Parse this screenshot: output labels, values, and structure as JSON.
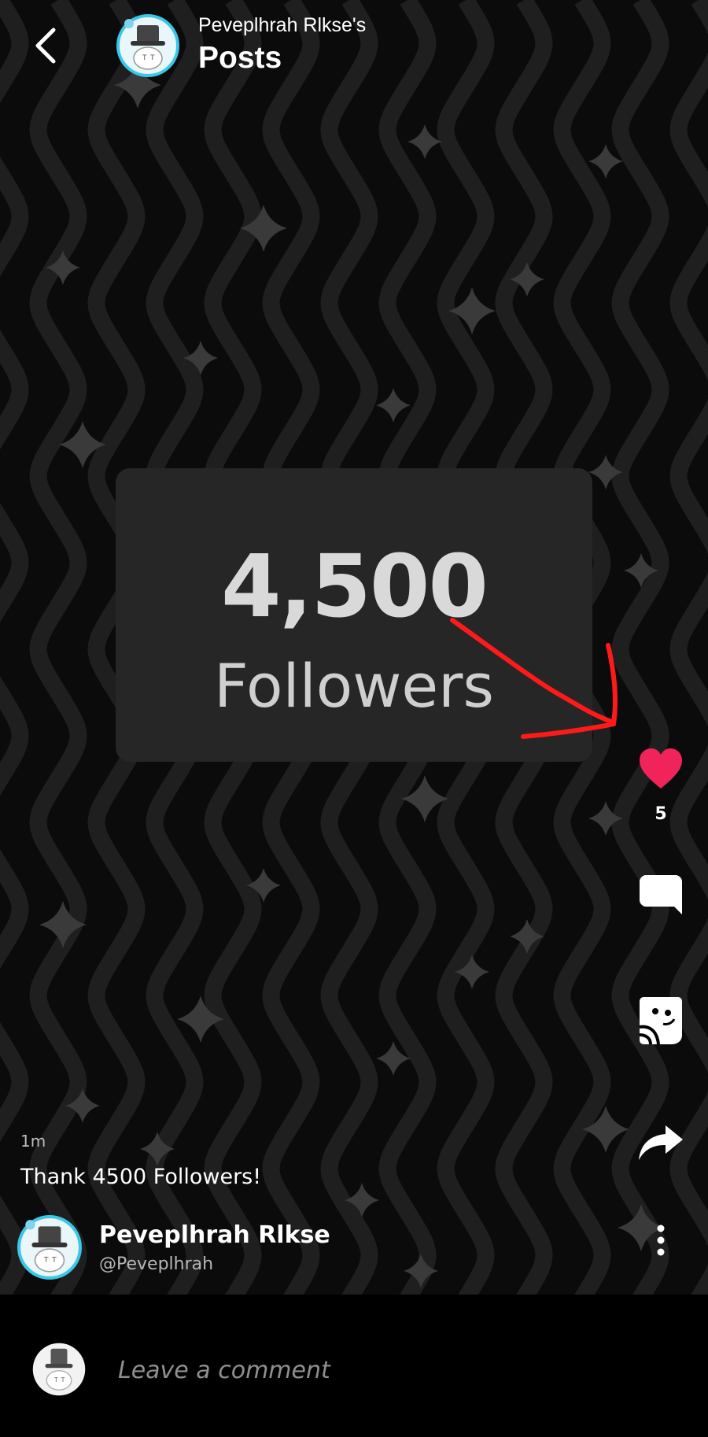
{
  "header": {
    "owner_label": "Peveplhrah Rlkse's",
    "title": "Posts",
    "back_icon": "chevron-left-icon"
  },
  "post": {
    "card_number": "4,500",
    "card_label": "Followers",
    "time": "1m",
    "caption": "Thank 4500 Followers!"
  },
  "author": {
    "name": "Peveplhrah Rlkse",
    "handle": "@Peveplhrah"
  },
  "actions": {
    "like_count": "5",
    "like_icon": "heart-icon",
    "comment_icon": "speech-bubble-icon",
    "sticker_icon": "sticker-icon",
    "share_icon": "share-arrow-icon",
    "more_icon": "more-vertical-icon"
  },
  "comment": {
    "placeholder": "Leave a comment"
  },
  "colors": {
    "background": "#0b0b0b",
    "wave": "#1f1f1f",
    "card": "#262626",
    "like": "#f0245a",
    "annotation": "#ff1a1a"
  }
}
